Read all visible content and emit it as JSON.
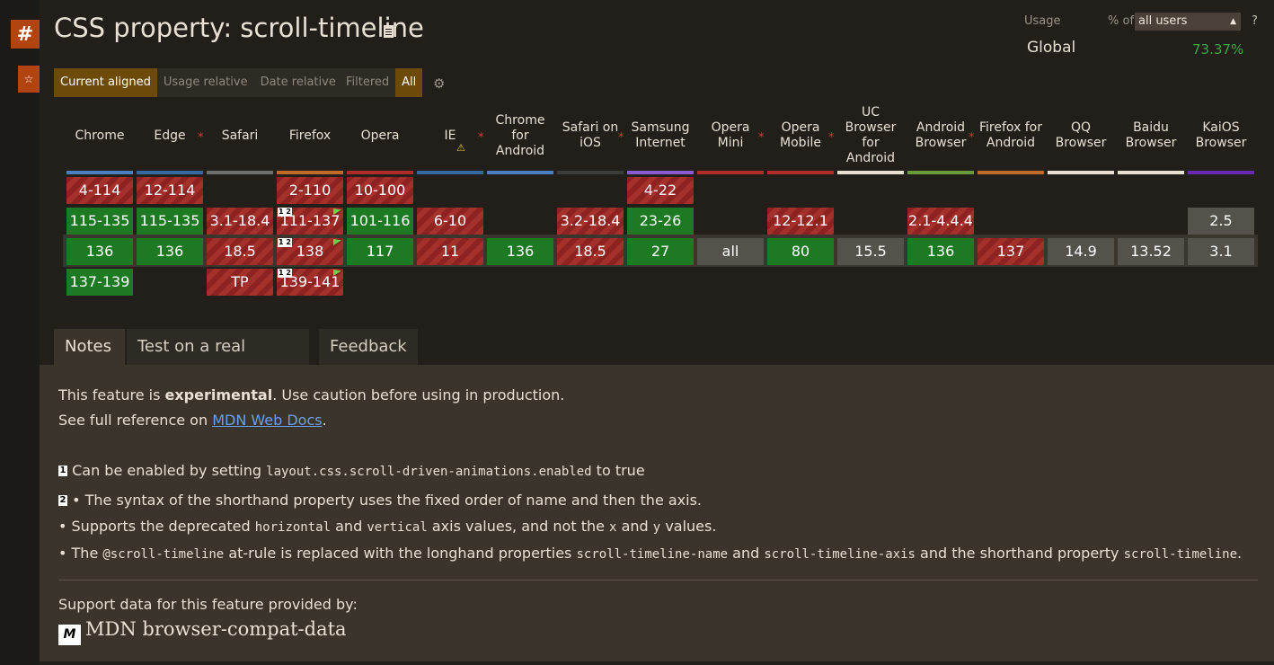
{
  "page": {
    "title": "CSS property: scroll-timeline",
    "hash_glyph": "#",
    "star_glyph": "☆",
    "doc_icon": "document-icon"
  },
  "usage": {
    "usage_label": "Usage",
    "pct_of_label": "% of",
    "users_select": "all users",
    "help": "?",
    "global_label": "Global",
    "global_value": "73.37%",
    "global_color": "#39a845"
  },
  "view_tabs": [
    {
      "label": "Current aligned",
      "active": true
    },
    {
      "label": "Usage relative",
      "active": false
    },
    {
      "label": "Date relative",
      "active": false
    }
  ],
  "filter": {
    "filtered_label": "Filtered",
    "all_label": "All"
  },
  "colors": {
    "supported": "#1e7a22",
    "unsupported": "#a3302a",
    "unknown": "#55524c",
    "accent": "#b1440f"
  },
  "browsers": [
    {
      "name": "Chrome",
      "color": "#4a7fc0"
    },
    {
      "name": "Edge",
      "color": "#356aa0",
      "asterisk": true
    },
    {
      "name": "Safari",
      "color": "#6e6e6e"
    },
    {
      "name": "Firefox",
      "color": "#c06a2a"
    },
    {
      "name": "Opera",
      "color": "#b02a2a"
    },
    {
      "name": "IE",
      "color": "#356aa0",
      "asterisk": true,
      "warning": true
    },
    {
      "name": "Chrome for Android",
      "color": "#4a7fc0"
    },
    {
      "name": "Safari on iOS",
      "color": "#3a3a3a",
      "asterisk": true
    },
    {
      "name": "Samsung Internet",
      "color": "#8a5ad0"
    },
    {
      "name": "Opera Mini",
      "color": "#b02a2a",
      "asterisk": true
    },
    {
      "name": "Opera Mobile",
      "color": "#b02a2a",
      "asterisk": true
    },
    {
      "name": "UC Browser for Android",
      "color": "#e8e0d2"
    },
    {
      "name": "Android Browser",
      "color": "#6a9a3a",
      "asterisk": true
    },
    {
      "name": "Firefox for Android",
      "color": "#c06a2a"
    },
    {
      "name": "QQ Browser",
      "color": "#e8e0d2"
    },
    {
      "name": "Baidu Browser",
      "color": "#e8e0d2"
    },
    {
      "name": "KaiOS Browser",
      "color": "#6a2ab0"
    }
  ],
  "cells": [
    [
      {
        "v": "4-114",
        "s": "n"
      },
      {
        "v": "115-135",
        "s": "y"
      },
      {
        "v": "136",
        "s": "y"
      },
      {
        "v": "137-139",
        "s": "y"
      }
    ],
    [
      {
        "v": "12-114",
        "s": "n"
      },
      {
        "v": "115-135",
        "s": "y"
      },
      {
        "v": "136",
        "s": "y"
      },
      null
    ],
    [
      null,
      {
        "v": "3.1-18.4",
        "s": "n"
      },
      {
        "v": "18.5",
        "s": "n"
      },
      {
        "v": "TP",
        "s": "n"
      }
    ],
    [
      {
        "v": "2-110",
        "s": "n"
      },
      {
        "v": "111-137",
        "s": "n",
        "badge": "1 2",
        "flag": true
      },
      {
        "v": "138",
        "s": "n",
        "badge": "1 2",
        "flag": true
      },
      {
        "v": "139-141",
        "s": "n",
        "badge": "1 2",
        "flag": true
      }
    ],
    [
      {
        "v": "10-100",
        "s": "n"
      },
      {
        "v": "101-116",
        "s": "y"
      },
      {
        "v": "117",
        "s": "y"
      },
      null
    ],
    [
      null,
      {
        "v": "6-10",
        "s": "n"
      },
      {
        "v": "11",
        "s": "n"
      },
      null
    ],
    [
      null,
      null,
      {
        "v": "136",
        "s": "y"
      },
      null
    ],
    [
      null,
      {
        "v": "3.2-18.4",
        "s": "n"
      },
      {
        "v": "18.5",
        "s": "n"
      },
      null
    ],
    [
      {
        "v": "4-22",
        "s": "n"
      },
      {
        "v": "23-26",
        "s": "y"
      },
      {
        "v": "27",
        "s": "y"
      },
      null
    ],
    [
      null,
      null,
      {
        "v": "all",
        "s": "u"
      },
      null
    ],
    [
      null,
      {
        "v": "12-12.1",
        "s": "n"
      },
      {
        "v": "80",
        "s": "y"
      },
      null
    ],
    [
      null,
      null,
      {
        "v": "15.5",
        "s": "u"
      },
      null
    ],
    [
      null,
      {
        "v": "2.1-4.4.4",
        "s": "n"
      },
      {
        "v": "136",
        "s": "y"
      },
      null
    ],
    [
      null,
      null,
      {
        "v": "137",
        "s": "n"
      },
      null
    ],
    [
      null,
      null,
      {
        "v": "14.9",
        "s": "u"
      },
      null
    ],
    [
      null,
      null,
      {
        "v": "13.52",
        "s": "u"
      },
      null
    ],
    [
      null,
      {
        "v": "2.5",
        "s": "u"
      },
      {
        "v": "3.1",
        "s": "u"
      },
      null
    ]
  ],
  "bottom_tabs": {
    "notes": "Notes",
    "test": "Test on a real browser",
    "feedback": "Feedback"
  },
  "notes": {
    "exp_prefix": "This feature is ",
    "exp_bold": "experimental",
    "exp_suffix": ". Use caution before using in production.",
    "ref_prefix": "See full reference on ",
    "ref_link": "MDN Web Docs",
    "ref_suffix": ".",
    "n1_badge": "1",
    "n1_text": "Can be enabled by setting",
    "n1_code": "layout.css.scroll-driven-animations.enabled",
    "n1_suffix": "to true",
    "n2_badge": "2",
    "n2_text": "• The syntax of the shorthand property uses the fixed order of name and then the axis.",
    "n3_a": "• Supports the deprecated",
    "n3_code1": "horizontal",
    "n3_b": "and",
    "n3_code2": "vertical",
    "n3_c": "axis values, and not the",
    "n3_code3": "x",
    "n3_d": "and",
    "n3_code4": "y",
    "n3_e": "values.",
    "n4_a": "• The",
    "n4_code1": "@scroll-timeline",
    "n4_b": "at-rule is replaced with the longhand properties",
    "n4_code2": "scroll-timeline-name",
    "n4_c": "and",
    "n4_code3": "scroll-timeline-axis",
    "n4_d": "and the shorthand property",
    "n4_code4": "scroll-timeline",
    "n4_e": ".",
    "support_label": "Support data for this feature provided by:",
    "mdn_logo": "M",
    "mdn_text": "MDN browser-compat-data"
  }
}
